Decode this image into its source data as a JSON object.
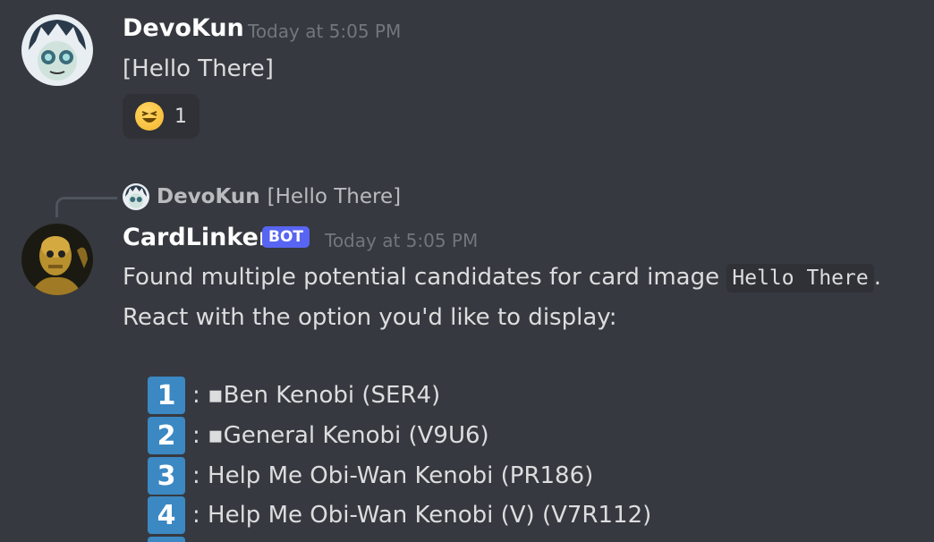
{
  "messages": [
    {
      "author": "DevoKun",
      "timestamp": "Today at 5:05 PM",
      "content": "[Hello There]",
      "reaction": {
        "emoji": "laughing-emoji",
        "count": "1"
      }
    },
    {
      "reply_to": {
        "author": "DevoKun",
        "text": "[Hello There]"
      },
      "author": "CardLinker",
      "badge": "BOT",
      "timestamp": "Today at 5:05 PM",
      "line1_prefix": "Found multiple potential candidates for card image ",
      "line1_code": "Hello There",
      "line1_suffix": ".",
      "line2": "React with the option you'd like to display:",
      "options": [
        {
          "key": "1",
          "text": ": ▪Ben Kenobi (SER4)"
        },
        {
          "key": "2",
          "text": ": ▪General Kenobi (V9U6)"
        },
        {
          "key": "3",
          "text": ": Help Me Obi-Wan Kenobi (PR186)"
        },
        {
          "key": "4",
          "text": ": Help Me Obi-Wan Kenobi (V) (V7R112)"
        }
      ]
    }
  ],
  "colors": {
    "background": "#36393f",
    "bot_badge": "#5865f2",
    "keycap": "#3b88c3"
  }
}
